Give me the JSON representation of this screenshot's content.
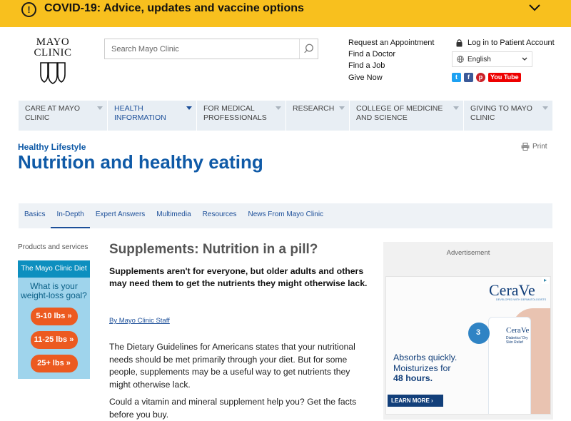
{
  "banner": {
    "alert_icon_glyph": "!",
    "text": "COVID-19: Advice, updates and vaccine options",
    "icon": "chevron-down-icon"
  },
  "header": {
    "logo_line1": "MAYO",
    "logo_line2": "CLINIC",
    "search_placeholder": "Search Mayo Clinic",
    "quick_links": [
      "Request an Appointment",
      "Find a Doctor",
      "Find a Job",
      "Give Now"
    ],
    "login_label": "Log in to Patient Account",
    "language": "English",
    "social": {
      "twitter": "t",
      "facebook": "f",
      "pinterest": "p",
      "youtube": "You Tube"
    }
  },
  "nav": {
    "items": [
      {
        "label": "CARE AT MAYO CLINIC"
      },
      {
        "label": "HEALTH INFORMATION"
      },
      {
        "label": "FOR MEDICAL PROFESSIONALS"
      },
      {
        "label": "RESEARCH"
      },
      {
        "label": "COLLEGE OF MEDICINE AND SCIENCE"
      },
      {
        "label": "GIVING TO MAYO CLINIC"
      }
    ],
    "active_index": 1
  },
  "page": {
    "section": "Healthy Lifestyle",
    "title": "Nutrition and healthy eating",
    "print_label": "Print"
  },
  "subnav": {
    "tabs": [
      "Basics",
      "In-Depth",
      "Expert Answers",
      "Multimedia",
      "Resources",
      "News From Mayo Clinic"
    ],
    "active": "In-Depth"
  },
  "sidebar": {
    "label": "Products and services",
    "diet": {
      "header": "The Mayo Clinic Diet",
      "question": "What is your weight-loss goal?",
      "buttons": [
        "5-10 lbs »",
        "11-25 lbs »",
        "25+ lbs »"
      ]
    }
  },
  "article": {
    "heading": "Supplements: Nutrition in a pill?",
    "lead": "Supplements aren't for everyone, but older adults and others may need them to get the nutrients they might otherwise lack.",
    "byline": "By Mayo Clinic Staff",
    "para1": "The Dietary Guidelines for Americans states that your nutritional needs should be met primarily through your diet. But for some people, supplements may be a useful way to get nutrients they might otherwise lack.",
    "para2": "Could a vitamin and mineral supplement help you? Get the facts before you buy."
  },
  "ad": {
    "label": "Advertisement",
    "brand": "CeraVe",
    "brand_tag": "DEVELOPED WITH DERMATOLOGISTS",
    "product_brand": "CeraVe",
    "product_name": "Diabetics' Dry Skin Relief",
    "seal_number": "3",
    "copy_line1": "Absorbs quickly.",
    "copy_line2": "Moisturizes for",
    "copy_line3": "48 hours.",
    "cta": "LEARN MORE ›",
    "adchoices_icon": "adchoices-icon"
  }
}
